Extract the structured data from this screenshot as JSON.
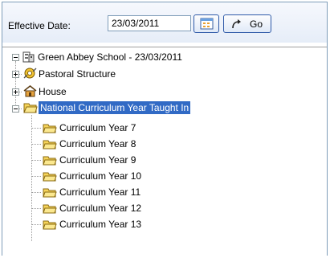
{
  "toolbar": {
    "effective_date_label": "Effective Date:",
    "date_value": "23/03/2011",
    "go_label": "Go"
  },
  "tree": {
    "root": "Green Abbey School - 23/03/2011",
    "pastoral": "Pastoral Structure",
    "house": "House",
    "national": "National Curriculum Year Taught In",
    "years": [
      "Curriculum Year  7",
      "Curriculum Year  8",
      "Curriculum Year  9",
      "Curriculum Year 10",
      "Curriculum Year 11",
      "Curriculum Year 12",
      "Curriculum Year 13"
    ]
  },
  "colors": {
    "selection": "#316ac5",
    "folder": "#f6d45a"
  }
}
